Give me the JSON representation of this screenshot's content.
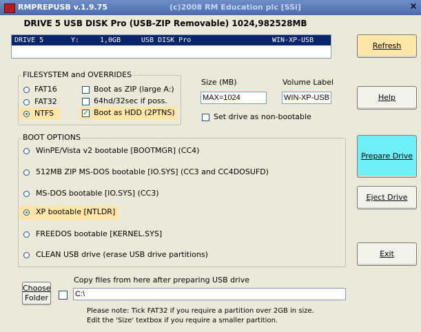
{
  "window": {
    "title": "RMPREPUSB v.1.9.75",
    "copyright": "(c)2008 RM Education plc [SSi]",
    "close_glyph": "×"
  },
  "drive_header": "DRIVE 5 USB DISK Pro  (USB-ZIP Removable) 1024,982528MB",
  "drive_list": {
    "row": [
      "DRIVE 5",
      "Y:",
      "1,0GB",
      "USB DISK Pro",
      "WIN-XP-USB"
    ]
  },
  "buttons": {
    "refresh": "Refresh",
    "help": "Help",
    "prepare": "Prepare Drive",
    "eject": "Eject Drive",
    "exit": "Exit",
    "choose_folder_line1": "Choose",
    "choose_folder_line2": "Folder"
  },
  "filesystem": {
    "legend": "FILESYSTEM and OVERRIDES",
    "fat16": "FAT16",
    "fat32": "FAT32",
    "ntfs": "NTFS",
    "boot_zip": "Boot as ZIP (large A:)",
    "hd64": "64hd/32sec if poss.",
    "boot_hdd": "Boot as HDD (2PTNS)",
    "selected": "NTFS"
  },
  "size": {
    "label": "Size (MB)",
    "value": "MAX=1024"
  },
  "volume": {
    "label": "Volume Label",
    "value": "WIN-XP-USB"
  },
  "nonbootable": "Set drive as non-bootable",
  "boot_options": {
    "legend": "BOOT OPTIONS",
    "items": [
      "WinPE/Vista v2 bootable [BOOTMGR]   (CC4)",
      "512MB ZIP MS-DOS bootable [IO.SYS]   (CC3 and CC4DOSUFD)",
      "MS-DOS bootable [IO.SYS]   (CC3)",
      "XP bootable [NTLDR]",
      "FREEDOS bootable [KERNEL.SYS]",
      "CLEAN USB drive (erase USB drive partitions)"
    ],
    "selected_index": 3
  },
  "copy": {
    "label": "Copy files from here after preparing USB drive",
    "path": "C:\\"
  },
  "note": {
    "line1": "Please note: Tick FAT32 if you require a partition over 2GB in size.",
    "line2": "Edit the 'Size' textbox if you require a smaller partition."
  },
  "colors": {
    "title_bar": "#4a6cb0",
    "selection": "#0a246a",
    "highlight": "#ffe5a8",
    "prepare_button": "#6ef0f8",
    "window_bg": "#ece9d8"
  }
}
